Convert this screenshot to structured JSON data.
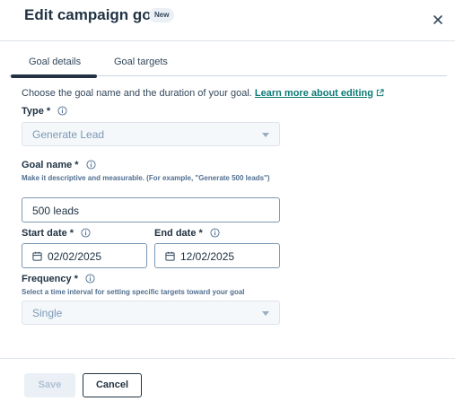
{
  "modal": {
    "title": "Edit campaign goal",
    "badge": "New",
    "close_icon": "close-icon"
  },
  "tabs": [
    {
      "label": "Goal details",
      "active": true
    },
    {
      "label": "Goal targets",
      "active": false
    }
  ],
  "intro": {
    "text": "Choose the goal name and the duration of your goal.",
    "link": "Learn more about editing",
    "link_icon": "external-link-icon"
  },
  "type_field": {
    "label": "Type *",
    "value": "Generate Lead",
    "disabled": true
  },
  "goal_name": {
    "label": "Goal name *",
    "hint": "Make it descriptive and measurable. (For example, \"Generate 500 leads\")",
    "value": "500 leads"
  },
  "start_date": {
    "label": "Start date *",
    "value": "02/02/2025"
  },
  "end_date": {
    "label": "End date *",
    "value": "12/02/2025"
  },
  "frequency": {
    "label": "Frequency *",
    "hint": "Select a time interval for setting specific targets toward your goal",
    "value": "Single",
    "disabled": true
  },
  "footer": {
    "save_label": "Save",
    "cancel_label": "Cancel"
  },
  "colors": {
    "link": "#0b7a75",
    "text": "#213343",
    "disabled_bg": "#f5f8fa"
  }
}
